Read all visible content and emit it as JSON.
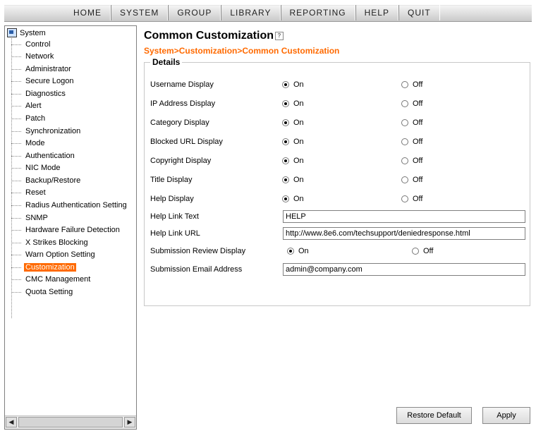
{
  "menu": [
    "HOME",
    "SYSTEM",
    "GROUP",
    "LIBRARY",
    "REPORTING",
    "HELP",
    "QUIT"
  ],
  "sidebar": {
    "root": "System",
    "items": [
      "Control",
      "Network",
      "Administrator",
      "Secure Logon",
      "Diagnostics",
      "Alert",
      "Patch",
      "Synchronization",
      "Mode",
      "Authentication",
      "NIC Mode",
      "Backup/Restore",
      "Reset",
      "Radius Authentication Setting",
      "SNMP",
      "Hardware Failure Detection",
      "X Strikes Blocking",
      "Warn Option Setting",
      "Customization",
      "CMC Management",
      "Quota Setting"
    ],
    "selected": "Customization"
  },
  "page": {
    "title": "Common Customization",
    "breadcrumb": "System>Customization>Common Customization",
    "section": "Details"
  },
  "radios": [
    {
      "label": "Username Display",
      "on": "On",
      "off": "Off",
      "value": "On"
    },
    {
      "label": "IP Address Display",
      "on": "On",
      "off": "Off",
      "value": "On"
    },
    {
      "label": "Category Display",
      "on": "On",
      "off": "Off",
      "value": "On"
    },
    {
      "label": "Blocked URL Display",
      "on": "On",
      "off": "Off",
      "value": "On"
    },
    {
      "label": "Copyright Display",
      "on": "On",
      "off": "Off",
      "value": "On"
    },
    {
      "label": "Title Display",
      "on": "On",
      "off": "Off",
      "value": "On"
    },
    {
      "label": "Help Display",
      "on": "On",
      "off": "Off",
      "value": "On"
    }
  ],
  "fields": {
    "help_link_text": {
      "label": "Help Link Text",
      "value": "HELP"
    },
    "help_link_url": {
      "label": "Help Link URL",
      "value": "http://www.8e6.com/techsupport/deniedresponse.html"
    },
    "submission_review": {
      "label": "Submission Review Display",
      "on": "On",
      "off": "Off",
      "value": "On"
    },
    "submission_email": {
      "label": "Submission Email Address",
      "value": "admin@company.com"
    }
  },
  "buttons": {
    "restore": "Restore Default",
    "apply": "Apply"
  },
  "colors": {
    "accent": "#ff6a00"
  }
}
